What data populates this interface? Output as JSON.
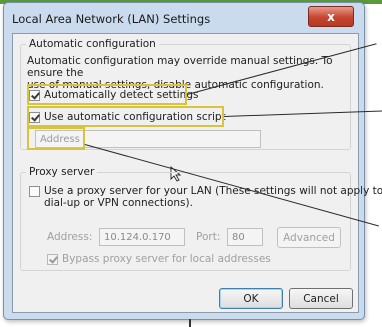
{
  "window": {
    "title": "Local Area Network (LAN) Settings",
    "close_symbol": "x"
  },
  "auto_config": {
    "legend": "Automatic configuration",
    "description_line1": "Automatic configuration may override manual settings.  To ensure the",
    "description_line2": "use of manual settings, disable automatic configuration.",
    "auto_detect": {
      "label": "Automatically detect settings",
      "checked": true
    },
    "use_script": {
      "label": "Use automatic configuration script",
      "checked": true
    },
    "address": {
      "placeholder": "Address",
      "value": ""
    }
  },
  "proxy": {
    "legend": "Proxy server",
    "use_proxy": {
      "label_line1": "Use a proxy server for your LAN (These settings will not apply to",
      "label_line2": "dial-up or VPN connections).",
      "checked": false
    },
    "address_label": "Address:",
    "address_value": "10.124.0.170",
    "port_label": "Port:",
    "port_value": "80",
    "advanced_label": "Advanced",
    "bypass": {
      "label": "Bypass proxy server for local addresses",
      "checked": true
    }
  },
  "buttons": {
    "ok": "OK",
    "cancel": "Cancel"
  },
  "colors": {
    "highlight": "#d9c33a",
    "accent": "#3c7fb1"
  }
}
